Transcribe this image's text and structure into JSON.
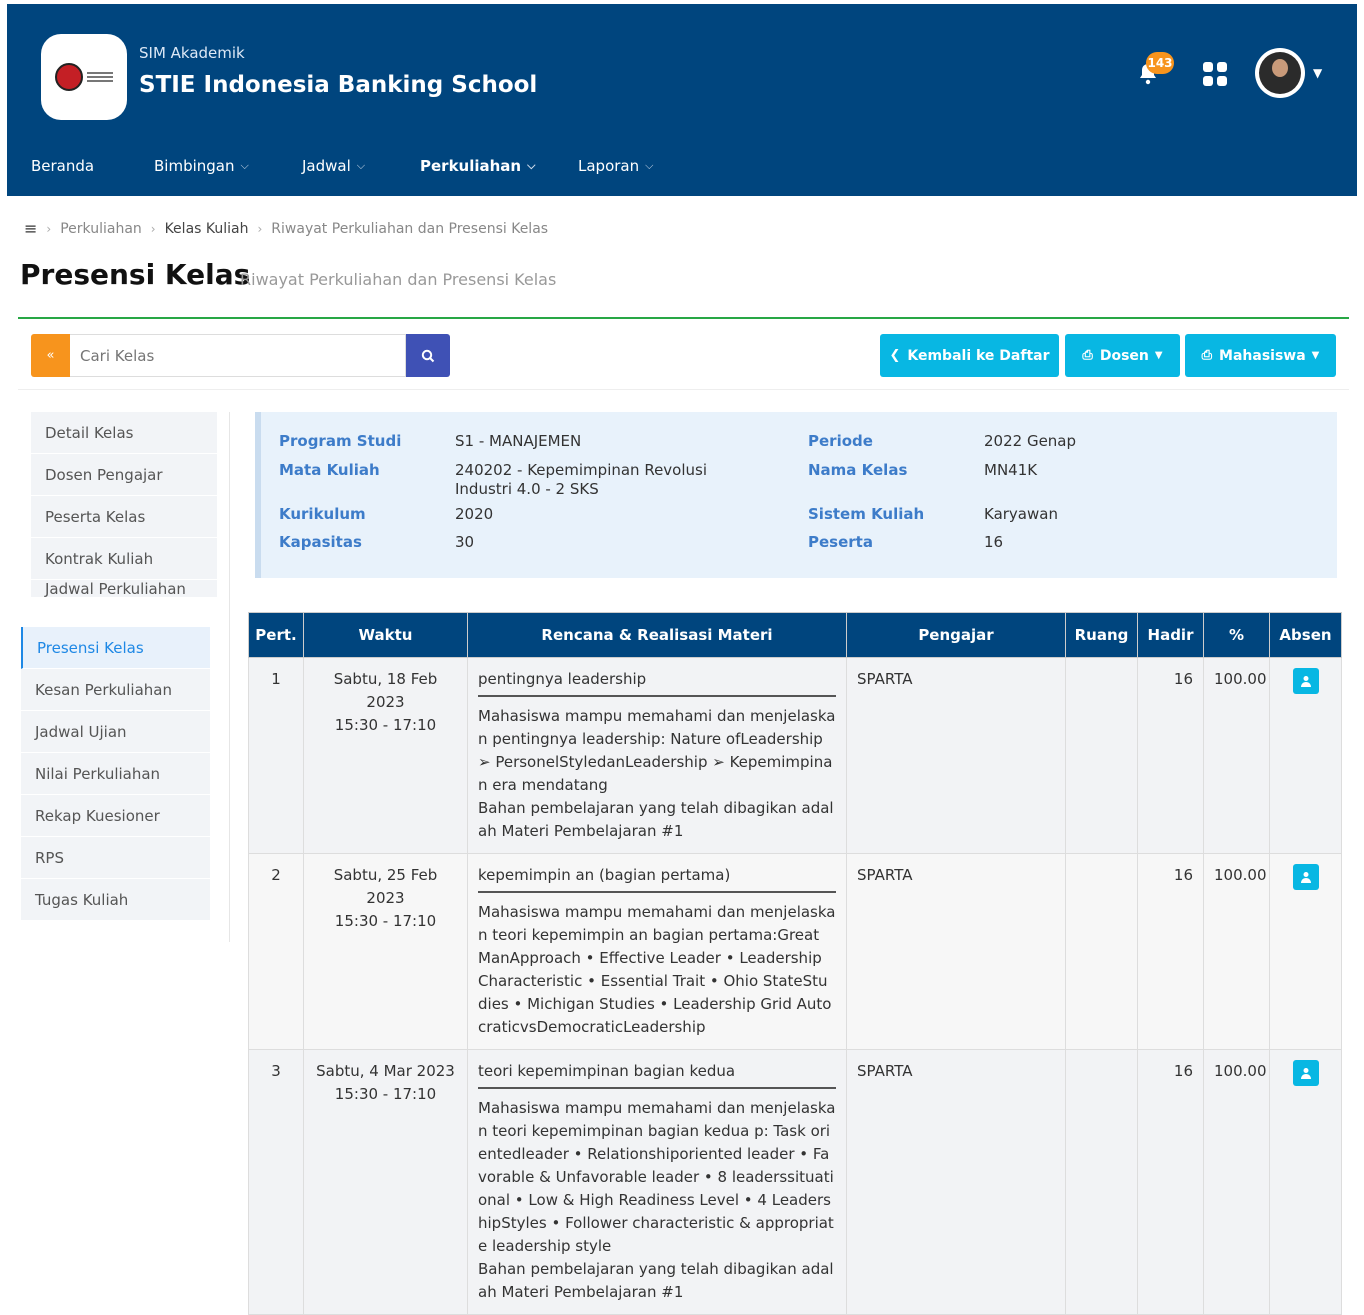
{
  "header": {
    "app_subtitle": "SIM Akademik",
    "app_title": "STIE Indonesia Banking School",
    "notification_count": "143"
  },
  "nav": [
    {
      "label": "Beranda",
      "dropdown": false
    },
    {
      "label": "Bimbingan",
      "dropdown": true
    },
    {
      "label": "Jadwal",
      "dropdown": true
    },
    {
      "label": "Perkuliahan",
      "dropdown": true,
      "active": true
    },
    {
      "label": "Laporan",
      "dropdown": true
    }
  ],
  "breadcrumb": [
    "Perkuliahan",
    "Kelas Kuliah",
    "Riwayat Perkuliahan dan Presensi Kelas"
  ],
  "page": {
    "title": "Presensi Kelas",
    "subtitle": "Riwayat Perkuliahan dan Presensi Kelas"
  },
  "toolbar": {
    "search_placeholder": "Cari Kelas",
    "back_label": "Kembali ke Daftar",
    "dosen_label": "Dosen",
    "mahasiswa_label": "Mahasiswa"
  },
  "sidebar": {
    "items": [
      "Detail Kelas",
      "Dosen Pengajar",
      "Peserta Kelas",
      "Kontrak Kuliah",
      "Jadwal Perkuliahan",
      "Presensi Kelas",
      "Kesan Perkuliahan",
      "Jadwal Ujian",
      "Nilai Perkuliahan",
      "Rekap Kuesioner",
      "RPS",
      "Tugas Kuliah"
    ],
    "active": "Presensi Kelas"
  },
  "info": {
    "program_studi_label": "Program Studi",
    "program_studi": "S1 - MANAJEMEN",
    "mata_kuliah_label": "Mata Kuliah",
    "mata_kuliah_line1": "240202 - Kepemimpinan Revolusi",
    "mata_kuliah_line2": "Industri 4.0 - 2 SKS",
    "kurikulum_label": "Kurikulum",
    "kurikulum": "2020",
    "kapasitas_label": "Kapasitas",
    "kapasitas": "30",
    "periode_label": "Periode",
    "periode": "2022 Genap",
    "nama_kelas_label": "Nama Kelas",
    "nama_kelas": "MN41K",
    "sistem_kuliah_label": "Sistem Kuliah",
    "sistem_kuliah": "Karyawan",
    "peserta_label": "Peserta",
    "peserta": "16"
  },
  "table": {
    "columns": [
      "Pert.",
      "Waktu",
      "Rencana & Realisasi Materi",
      "Pengajar",
      "Ruang",
      "Hadir",
      "%",
      "Absen"
    ],
    "rows": [
      {
        "pert": "1",
        "tanggal": "Sabtu, 18 Feb 2023",
        "jam": "15:30 - 17:10",
        "rencana": "pentingnya leadership",
        "realisasi": "Mahasiswa mampu memahami dan menjelaskan pentingnya leadership: Nature ofLeadership ➢ PersonelStyledanLeadership ➢ Kepemimpinan era mendatang\nBahan pembelajaran yang telah dibagikan adalah Materi Pembelajaran #1",
        "pengajar": "SPARTA",
        "ruang": "",
        "hadir": "16",
        "persen": "100.00"
      },
      {
        "pert": "2",
        "tanggal": "Sabtu, 25 Feb 2023",
        "jam": "15:30 - 17:10",
        "rencana": "kepemimpin an (bagian pertama)",
        "realisasi": "Mahasiswa mampu memahami dan menjelaskan teori kepemimpin an bagian pertama:Great ManApproach • Effective Leader • Leadership Characteristic • Essential Trait • Ohio StateStudies • Michigan Studies • Leadership Grid AutocraticvsDemocraticLeadership",
        "pengajar": "SPARTA",
        "ruang": "",
        "hadir": "16",
        "persen": "100.00"
      },
      {
        "pert": "3",
        "tanggal": "Sabtu, 4 Mar 2023",
        "jam": "15:30 - 17:10",
        "rencana": "teori kepemimpinan bagian kedua",
        "realisasi": "Mahasiswa mampu memahami dan menjelaskan teori kepemimpinan bagian kedua p: Task orientedleader • Relationshiporiented leader • Favorable & Unfavorable leader • 8 leaderssituational • Low & High Readiness Level • 4 LeadershipStyles • Follower characteristic & appropriate leadership style\nBahan pembelajaran yang telah dibagikan adalah Materi Pembelajaran #1",
        "pengajar": "SPARTA",
        "ruang": "",
        "hadir": "16",
        "persen": "100.00"
      }
    ]
  },
  "colors": {
    "header_bg": "#00457e",
    "accent_orange": "#f7941d",
    "accent_cyan": "#08b7e3",
    "accent_indigo": "#3f51b5",
    "panel_border": "#28a745"
  }
}
